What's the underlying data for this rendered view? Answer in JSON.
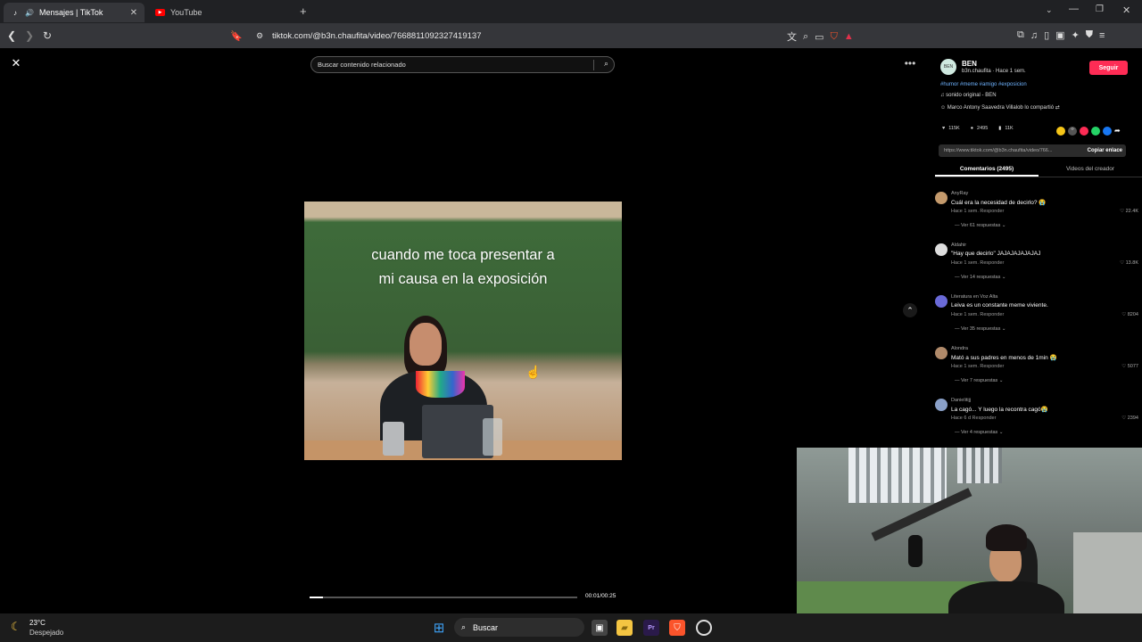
{
  "browser": {
    "tabs": [
      {
        "label": "Mensajes | TikTok",
        "active": true
      },
      {
        "label": "YouTube",
        "active": false
      }
    ],
    "new_tab": "+",
    "url": "tiktok.com/@b3n.chaufita/video/7668811092327419137"
  },
  "video": {
    "search_placeholder": "Buscar contenido relacionado",
    "caption_line1": "cuando me toca presentar a",
    "caption_line2": "mi causa en la exposición",
    "time": "00:01/00:25",
    "progress": 0.05
  },
  "panel": {
    "author_name": "BEN",
    "author_sub": "b3n.chaufita · Hace 1 sem.",
    "follow_label": "Seguir",
    "hashtags": "#humor #meme #amigo #exposicion",
    "sound": "sonido original - BEN",
    "shared_by": "Marco Antony Saavedra Villalob lo compartió",
    "likes": "115K",
    "comments_count": "2495",
    "saves": "11K",
    "link": "https://www.tiktok.com/@b3n.chaufita/video/766...",
    "copy_label": "Copiar enlace",
    "tab_comments": "Comentarios (2495)",
    "tab_creator": "Videos del creador"
  },
  "comments": [
    {
      "user": "AnyRay",
      "text": "Cuál era la necesidad de decirlo? 😭",
      "meta": "Hace 1 sem.   Responder",
      "likes": "22.4K",
      "replies": "Ver 61 respuestas ⌄",
      "color": "#c49a6c"
    },
    {
      "user": "Aldahir",
      "text": "\"Hay que decirlo\" JAJAJAJAJAJAJ",
      "meta": "Hace 1 sem.   Responder",
      "likes": "13.8K",
      "replies": "Ver 14 respuestas ⌄",
      "color": "#dddddd"
    },
    {
      "user": "Literatura en Voz Alta",
      "text": "Leiva es un constante meme viviente.",
      "meta": "Hace 1 sem.   Responder",
      "likes": "8204",
      "replies": "Ver 35 respuestas ⌄",
      "color": "#6a6ad8"
    },
    {
      "user": "Alondra",
      "text": "Mató a sus padres en menos de 1min 😭",
      "meta": "Hace 1 sem.   Responder",
      "likes": "5077",
      "replies": "Ver 7 respuestas ⌄",
      "color": "#b08a6a"
    },
    {
      "user": "Danielitijj",
      "text": "La cagó... Y luego la recontra cagó😭",
      "meta": "Hace 6 d   Responder",
      "likes": "2394",
      "replies": "Ver 4 respuestas ⌄",
      "color": "#8aa0c8"
    }
  ],
  "taskbar": {
    "weather_temp": "23°C",
    "weather_desc": "Despejado",
    "search_label": "Buscar"
  }
}
